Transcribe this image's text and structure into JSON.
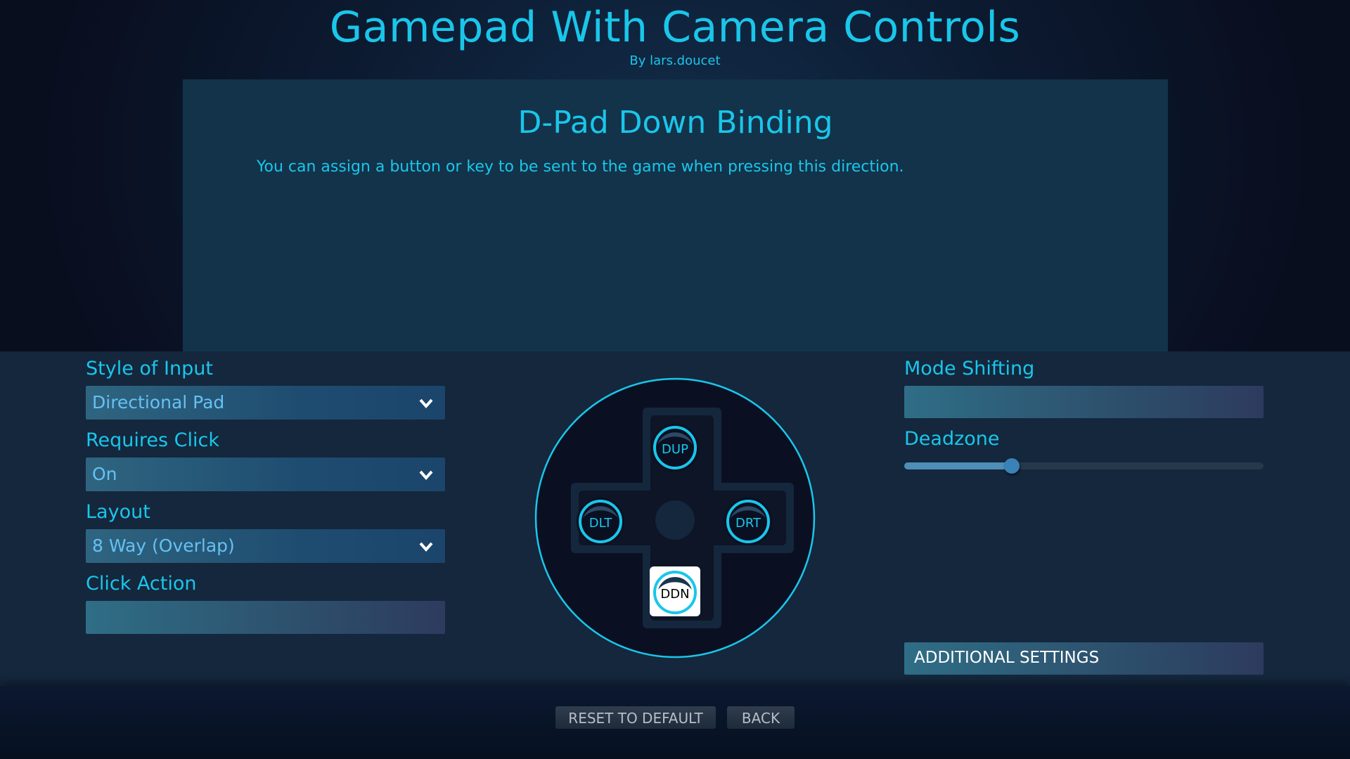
{
  "header": {
    "title": "Gamepad With Camera Controls",
    "author": "By lars.doucet"
  },
  "panel": {
    "title": "D-Pad Down Binding",
    "description": "You can assign a button or key to be sent to the game when pressing this direction."
  },
  "left_settings": {
    "style_of_input": {
      "label": "Style of Input",
      "value": "Directional Pad"
    },
    "requires_click": {
      "label": "Requires Click",
      "value": "On"
    },
    "layout": {
      "label": "Layout",
      "value": "8 Way (Overlap)"
    },
    "click_action": {
      "label": "Click Action",
      "value": ""
    }
  },
  "dpad": {
    "buttons": {
      "up": "DUP",
      "left": "DLT",
      "right": "DRT",
      "down": "DDN"
    },
    "selected": "down",
    "accent_color": "#1ac6ea"
  },
  "right_settings": {
    "mode_shifting": {
      "label": "Mode Shifting",
      "value": ""
    },
    "deadzone": {
      "label": "Deadzone",
      "value_fraction": 0.3
    },
    "additional_settings_label": "ADDITIONAL SETTINGS"
  },
  "footer": {
    "reset_label": "RESET TO DEFAULT",
    "back_label": "BACK"
  },
  "colors": {
    "accent": "#1ac6ea",
    "dropdown_text": "#66c0f4",
    "panel_bg": "#13334a",
    "settings_bg": "#14273d"
  }
}
